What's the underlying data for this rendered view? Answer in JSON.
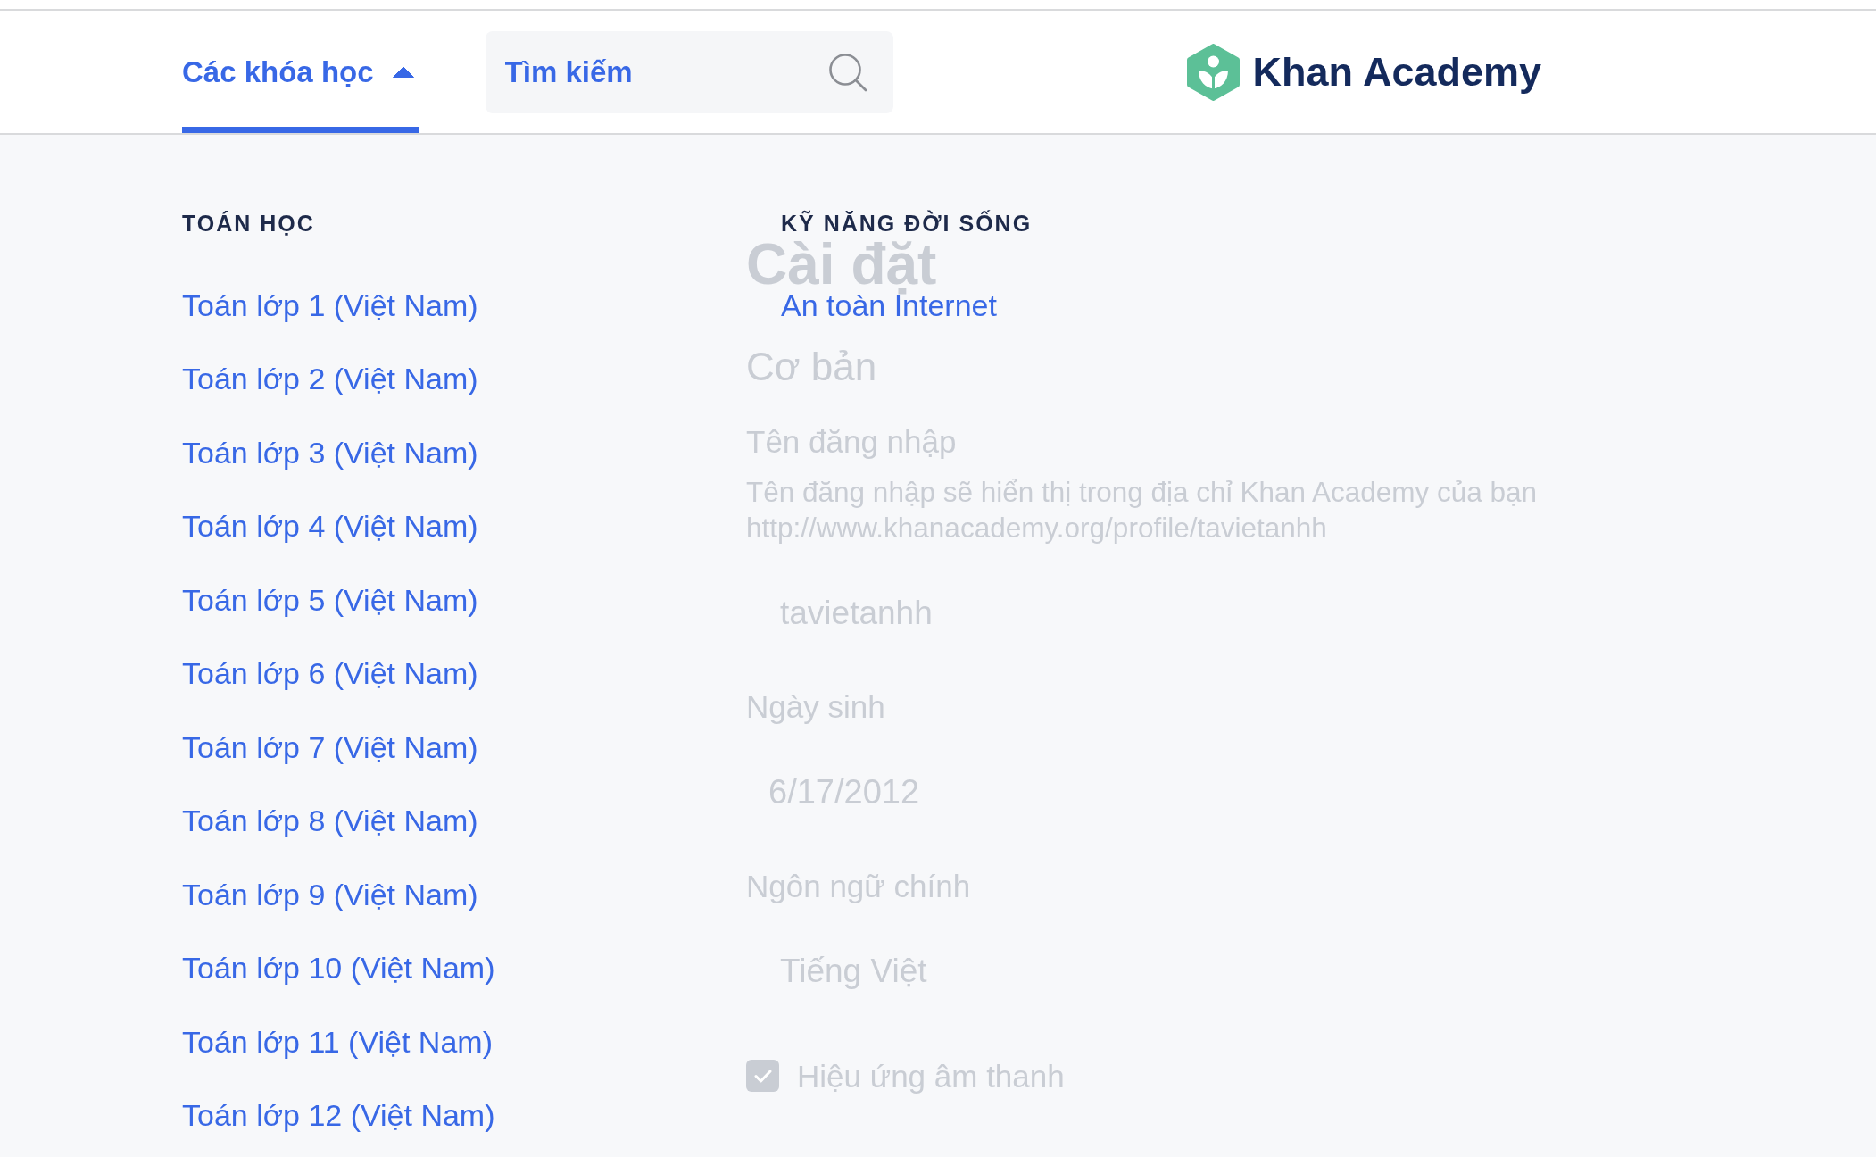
{
  "header": {
    "courses_tab": {
      "label": "Các khóa học",
      "selected": true,
      "expanded": true
    },
    "search": {
      "placeholder": "Tìm kiếm"
    },
    "logo": {
      "text": "Khan Academy"
    }
  },
  "courses_menu": {
    "columns": [
      {
        "heading": "TOÁN HỌC",
        "items": [
          "Toán lớp 1 (Việt Nam)",
          "Toán lớp 2 (Việt Nam)",
          "Toán lớp 3 (Việt Nam)",
          "Toán lớp 4 (Việt Nam)",
          "Toán lớp 5 (Việt Nam)",
          "Toán lớp 6 (Việt Nam)",
          "Toán lớp 7 (Việt Nam)",
          "Toán lớp 8 (Việt Nam)",
          "Toán lớp 9 (Việt Nam)",
          "Toán lớp 10 (Việt Nam)",
          "Toán lớp 11 (Việt Nam)",
          "Toán lớp 12 (Việt Nam)"
        ]
      },
      {
        "heading": "KỸ NĂNG ĐỜI SỐNG",
        "items": [
          "An toàn Internet"
        ]
      }
    ]
  },
  "background_page": {
    "title": "Cài đặt",
    "section": "Cơ bản",
    "fields": [
      {
        "kind": "text",
        "label": "Tên đăng nhập",
        "description": "Tên đăng nhập sẽ hiển thị trong địa chỉ Khan Academy của bạn",
        "url": "http://www.khanacademy.org/profile/tavietanhh",
        "value": "tavietanhh"
      },
      {
        "kind": "date",
        "label": "Ngày sinh",
        "value": "6/17/2012"
      },
      {
        "kind": "text",
        "label": "Ngôn ngữ chính",
        "value": "Tiếng Việt"
      },
      {
        "kind": "checkbox",
        "label": "Hiệu ứng âm thanh",
        "checked": true
      }
    ]
  }
}
